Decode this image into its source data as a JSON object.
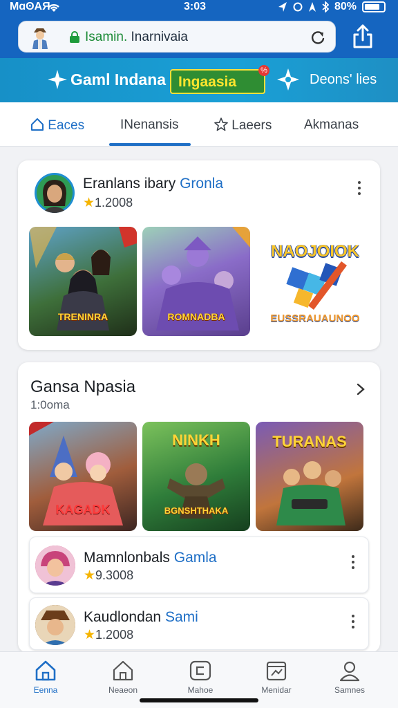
{
  "status_bar": {
    "carrier": "MɑʘAЯ",
    "time": "3:03",
    "battery": "80%",
    "battery_level": 0.8
  },
  "browser": {
    "url_prefix": "Isamin.",
    "url_rest": " Inarnivaia"
  },
  "banner": {
    "title": "Gaml Indana",
    "badge": "Ingaasia",
    "badge_tag": "%",
    "link": "Deons' lies"
  },
  "tabs": [
    {
      "label": "Eaces"
    },
    {
      "label": "INenansis"
    },
    {
      "label": "Laeers"
    },
    {
      "label": "Akmanas"
    }
  ],
  "featured_card": {
    "title": "Eranlans ibary",
    "title_accent": "Gronla",
    "rating": "1.2008",
    "thumbnails": [
      {
        "label": "TRENINRA"
      },
      {
        "label": "ROMNADBA"
      },
      {
        "label": "NAOJOIOK",
        "caption": "EUSSRAUAUNOO"
      }
    ]
  },
  "section": {
    "title": "Gansa Npasia",
    "subtitle": "1:0oma",
    "thumbnails": [
      {
        "label": "KAGADK"
      },
      {
        "label": "NINKH",
        "caption": "BGNSHTHAKA"
      },
      {
        "label": "TURANAS"
      }
    ],
    "items": [
      {
        "title": "Mamnlonbals",
        "title_accent": "Gamla",
        "rating": "9.3008"
      },
      {
        "title": "Kaudlondan",
        "title_accent": "Sami",
        "rating": "1.2008"
      }
    ]
  },
  "bottom_nav": [
    {
      "label": "Eenna",
      "icon": "home-icon"
    },
    {
      "label": "Neaeon",
      "icon": "house-icon"
    },
    {
      "label": "Mahoe",
      "icon": "message-icon"
    },
    {
      "label": "Menidar",
      "icon": "calendar-icon"
    },
    {
      "label": "Samnes",
      "icon": "profile-icon"
    }
  ],
  "colors": {
    "brand_blue": "#1565c0",
    "accent_blue": "#1f6fc6",
    "banner": "#1aa0d6",
    "badge_green": "#2f8d33",
    "badge_yellow": "#ffe52e"
  }
}
